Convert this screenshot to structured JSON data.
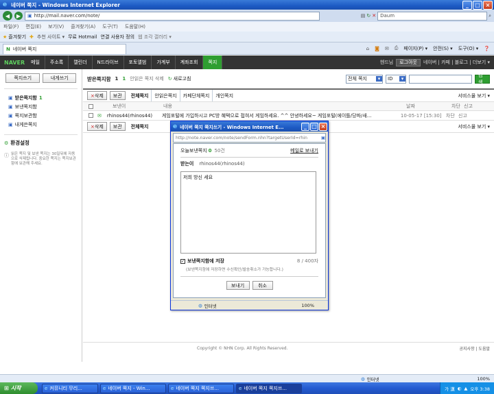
{
  "window": {
    "title": "네이버 쪽지 - Windows Internet Explorer",
    "tab_title": "네이버 쪽지"
  },
  "ie": {
    "address": "http://mail.naver.com/note/",
    "search_text": "Daum",
    "menu": [
      "파일(F)",
      "편집(E)",
      "보기(V)",
      "즐겨찾기(A)",
      "도구(T)",
      "도움말(H)"
    ],
    "favorites": {
      "label": "즐겨찾기",
      "items": [
        "추천 사이트 ▾",
        "무료 Hotmail",
        "연결 사용자 정의",
        "웹 조각 갤러리 ▾"
      ]
    },
    "cmd": [
      "페이지(P) ▾",
      "안전(S) ▾",
      "도구(O) ▾"
    ]
  },
  "naver": {
    "logo": "NAVER",
    "nav": [
      "메일",
      "주소록",
      "캘린더",
      "N드라이브",
      "포토앨범",
      "가계부",
      "계좌조회",
      "쪽지"
    ],
    "nav_active_index": 7,
    "user": {
      "name": "헨드님",
      "logout": "로그아웃",
      "links": "네이버 | 카페 | 블로그 | 더보기 ▾"
    },
    "side": {
      "write": "쪽지쓰기",
      "to_me": "내게쓰기",
      "folders": [
        {
          "label": "받은쪽지함",
          "count": "1"
        },
        {
          "label": "보낸쪽지함",
          "count": ""
        },
        {
          "label": "쪽지보관함",
          "count": ""
        },
        {
          "label": "내게쓴쪽지",
          "count": ""
        }
      ],
      "settings": "환경설정",
      "notice": "읽은 쪽지 및 보낸 쪽지는 30일뒤에 자동으로 삭제됩니다. 중요한 쪽지는 쪽지보관함에 보관해 주세요."
    },
    "inbox": {
      "title": "받은쪽지함",
      "count": "1",
      "unread": "1",
      "unread_label": "안읽은 쪽지 삭제",
      "refresh": "새로고침",
      "search_scope": "전체 쪽지",
      "search_field": "ID",
      "search_btn": "검색",
      "delete": "삭제",
      "keep": "보관",
      "filters": [
        "전체쪽지",
        "안읽은쪽지",
        "카페단체쪽지",
        "개인쪽지"
      ],
      "service": "서비스물 보기 ▾",
      "headers": {
        "sender": "보낸이",
        "content": "내용",
        "date": "날짜",
        "block": "차단",
        "report": "신고"
      },
      "rows": [
        {
          "sender": "rhinos44(rhinos44)",
          "content": "게임포털에 가입하시고 PC방 혜택으로 접혀서 게임하세요. ^^ 안녕하세요~ 게임포털(에이틀/당파/새...",
          "date": "10-05-17 [15:30]",
          "block": "차단",
          "report": "신고"
        }
      ]
    },
    "footer": "Copyright © NHN Corp. All Rights Reserved.",
    "footer_links": "공지사항 | 도움말"
  },
  "popup": {
    "title": "네이버 쪽지 쪽지쓰기 - Windows Internet E...",
    "address": "http://note.naver.com/note/sendForm.nhn?targetUserId=rhin",
    "today_label": "오늘보낸쪽지",
    "today_count": "0",
    "limit": "50건",
    "mail_link": "메일로 보내기",
    "to_label": "받는이",
    "to_value": "rhinos44(rhinos44)",
    "body": "저희 방신 세요",
    "save_label": "보낸쪽지함에 저장",
    "char_count": "8 / 400자",
    "save_note": "(보낸쪽지함에 저장하면 수신확인/발송취소가 가능합니다.)",
    "send": "보내기",
    "cancel": "취소",
    "status": "인터넷",
    "zoom": "100%"
  },
  "status": {
    "zone": "인터넷",
    "zoom": "100%"
  },
  "taskbar": {
    "start": "시작",
    "items": [
      "커뮤니티 무리...",
      "네이버 쪽지 - Win...",
      "네이버 쪽지 쪽지쓰...",
      "네이버 쪽지 쪽지쓰..."
    ],
    "active_index": 3,
    "ime": "가 漢",
    "clock": "오후 3:38"
  },
  "colors": {
    "naver_green": "#2f9e31",
    "nav_bg": "#333",
    "ie_blue": "#245bd1"
  }
}
